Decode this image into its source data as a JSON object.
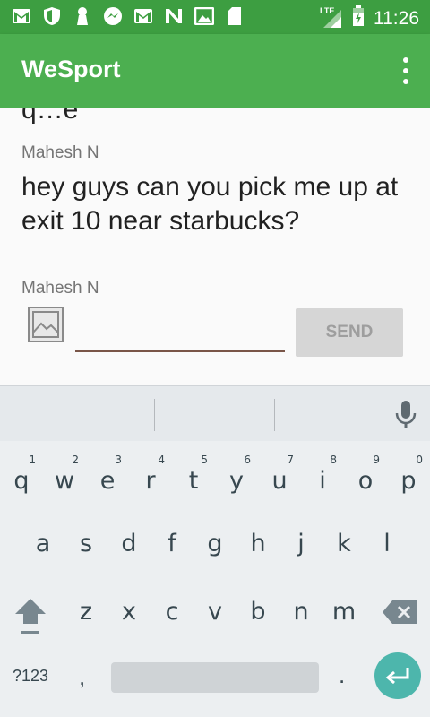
{
  "status_bar": {
    "icons": [
      "gmail-icon",
      "shield-icon",
      "keyhole-icon",
      "messenger-icon",
      "gmail-icon",
      "n-app-icon",
      "photo-icon",
      "sd-card-icon"
    ],
    "network": "LTE",
    "time": "11:26"
  },
  "app_bar": {
    "title": "WeSport"
  },
  "chat": {
    "previous_text_fragment": "q…e",
    "messages": [
      {
        "sender": "Mahesh N",
        "text": "hey guys can you pick me up at exit 10 near starbucks?"
      }
    ],
    "composer": {
      "sender": "Mahesh N",
      "input_value": "",
      "send_label": "SEND"
    }
  },
  "keyboard": {
    "row1": [
      {
        "key": "q",
        "hint": "1"
      },
      {
        "key": "w",
        "hint": "2"
      },
      {
        "key": "e",
        "hint": "3"
      },
      {
        "key": "r",
        "hint": "4"
      },
      {
        "key": "t",
        "hint": "5"
      },
      {
        "key": "y",
        "hint": "6"
      },
      {
        "key": "u",
        "hint": "7"
      },
      {
        "key": "i",
        "hint": "8"
      },
      {
        "key": "o",
        "hint": "9"
      },
      {
        "key": "p",
        "hint": "0"
      }
    ],
    "row2": [
      "a",
      "s",
      "d",
      "f",
      "g",
      "h",
      "j",
      "k",
      "l"
    ],
    "row3": [
      "z",
      "x",
      "c",
      "v",
      "b",
      "n",
      "m"
    ],
    "symbols_label": "?123",
    "comma": ",",
    "period": "."
  },
  "colors": {
    "status_bar": "#3d9e41",
    "app_bar": "#4caf50",
    "input_underline": "#795548",
    "enter_key": "#4db6ac"
  }
}
